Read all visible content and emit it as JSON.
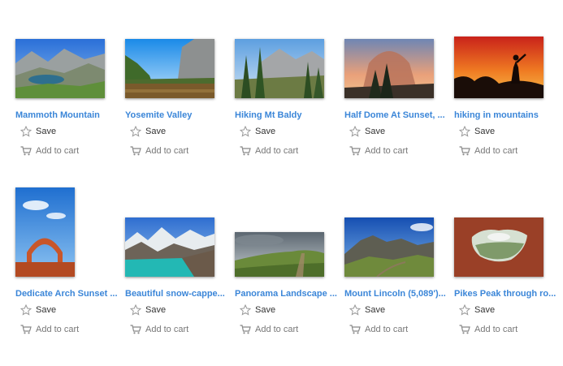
{
  "colors": {
    "title": "#3b86d8",
    "save_text": "#333333",
    "cart_text": "#777777"
  },
  "actions": {
    "save_label": "Save",
    "cart_label": "Add to cart",
    "save_icon": "star-outline-icon",
    "cart_icon": "shopping-cart-icon"
  },
  "items": [
    {
      "title": "Mammoth Mountain",
      "scene": "alpine-lake"
    },
    {
      "title": "Yosemite Valley",
      "scene": "valley-river"
    },
    {
      "title": "Hiking Mt Baldy",
      "scene": "pine-mountains"
    },
    {
      "title": "Half Dome At Sunset, ...",
      "scene": "dome-sunset"
    },
    {
      "title": "hiking in mountains",
      "scene": "silhouette-sunset"
    },
    {
      "title": "Dedicate Arch Sunset ...",
      "scene": "red-arch"
    },
    {
      "title": "Beautiful snow-cappe...",
      "scene": "turquoise-lake"
    },
    {
      "title": "Panorama Landscape ...",
      "scene": "green-ridge"
    },
    {
      "title": "Mount Lincoln (5,089')...",
      "scene": "mountain-peak"
    },
    {
      "title": "Pikes Peak through ro...",
      "scene": "rock-window"
    }
  ]
}
